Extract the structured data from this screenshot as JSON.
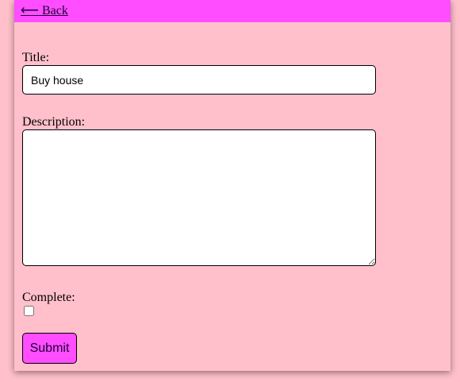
{
  "nav": {
    "back_label": "⟵ Back"
  },
  "form": {
    "title_label": "Title:",
    "title_value": "Buy house",
    "description_label": "Description:",
    "description_value": "",
    "complete_label": "Complete:",
    "complete_checked": false,
    "submit_label": "Submit"
  },
  "colors": {
    "page_background": "#ffc0cb",
    "top_bar": "#ff4dff",
    "submit_button": "#ff4dff"
  }
}
